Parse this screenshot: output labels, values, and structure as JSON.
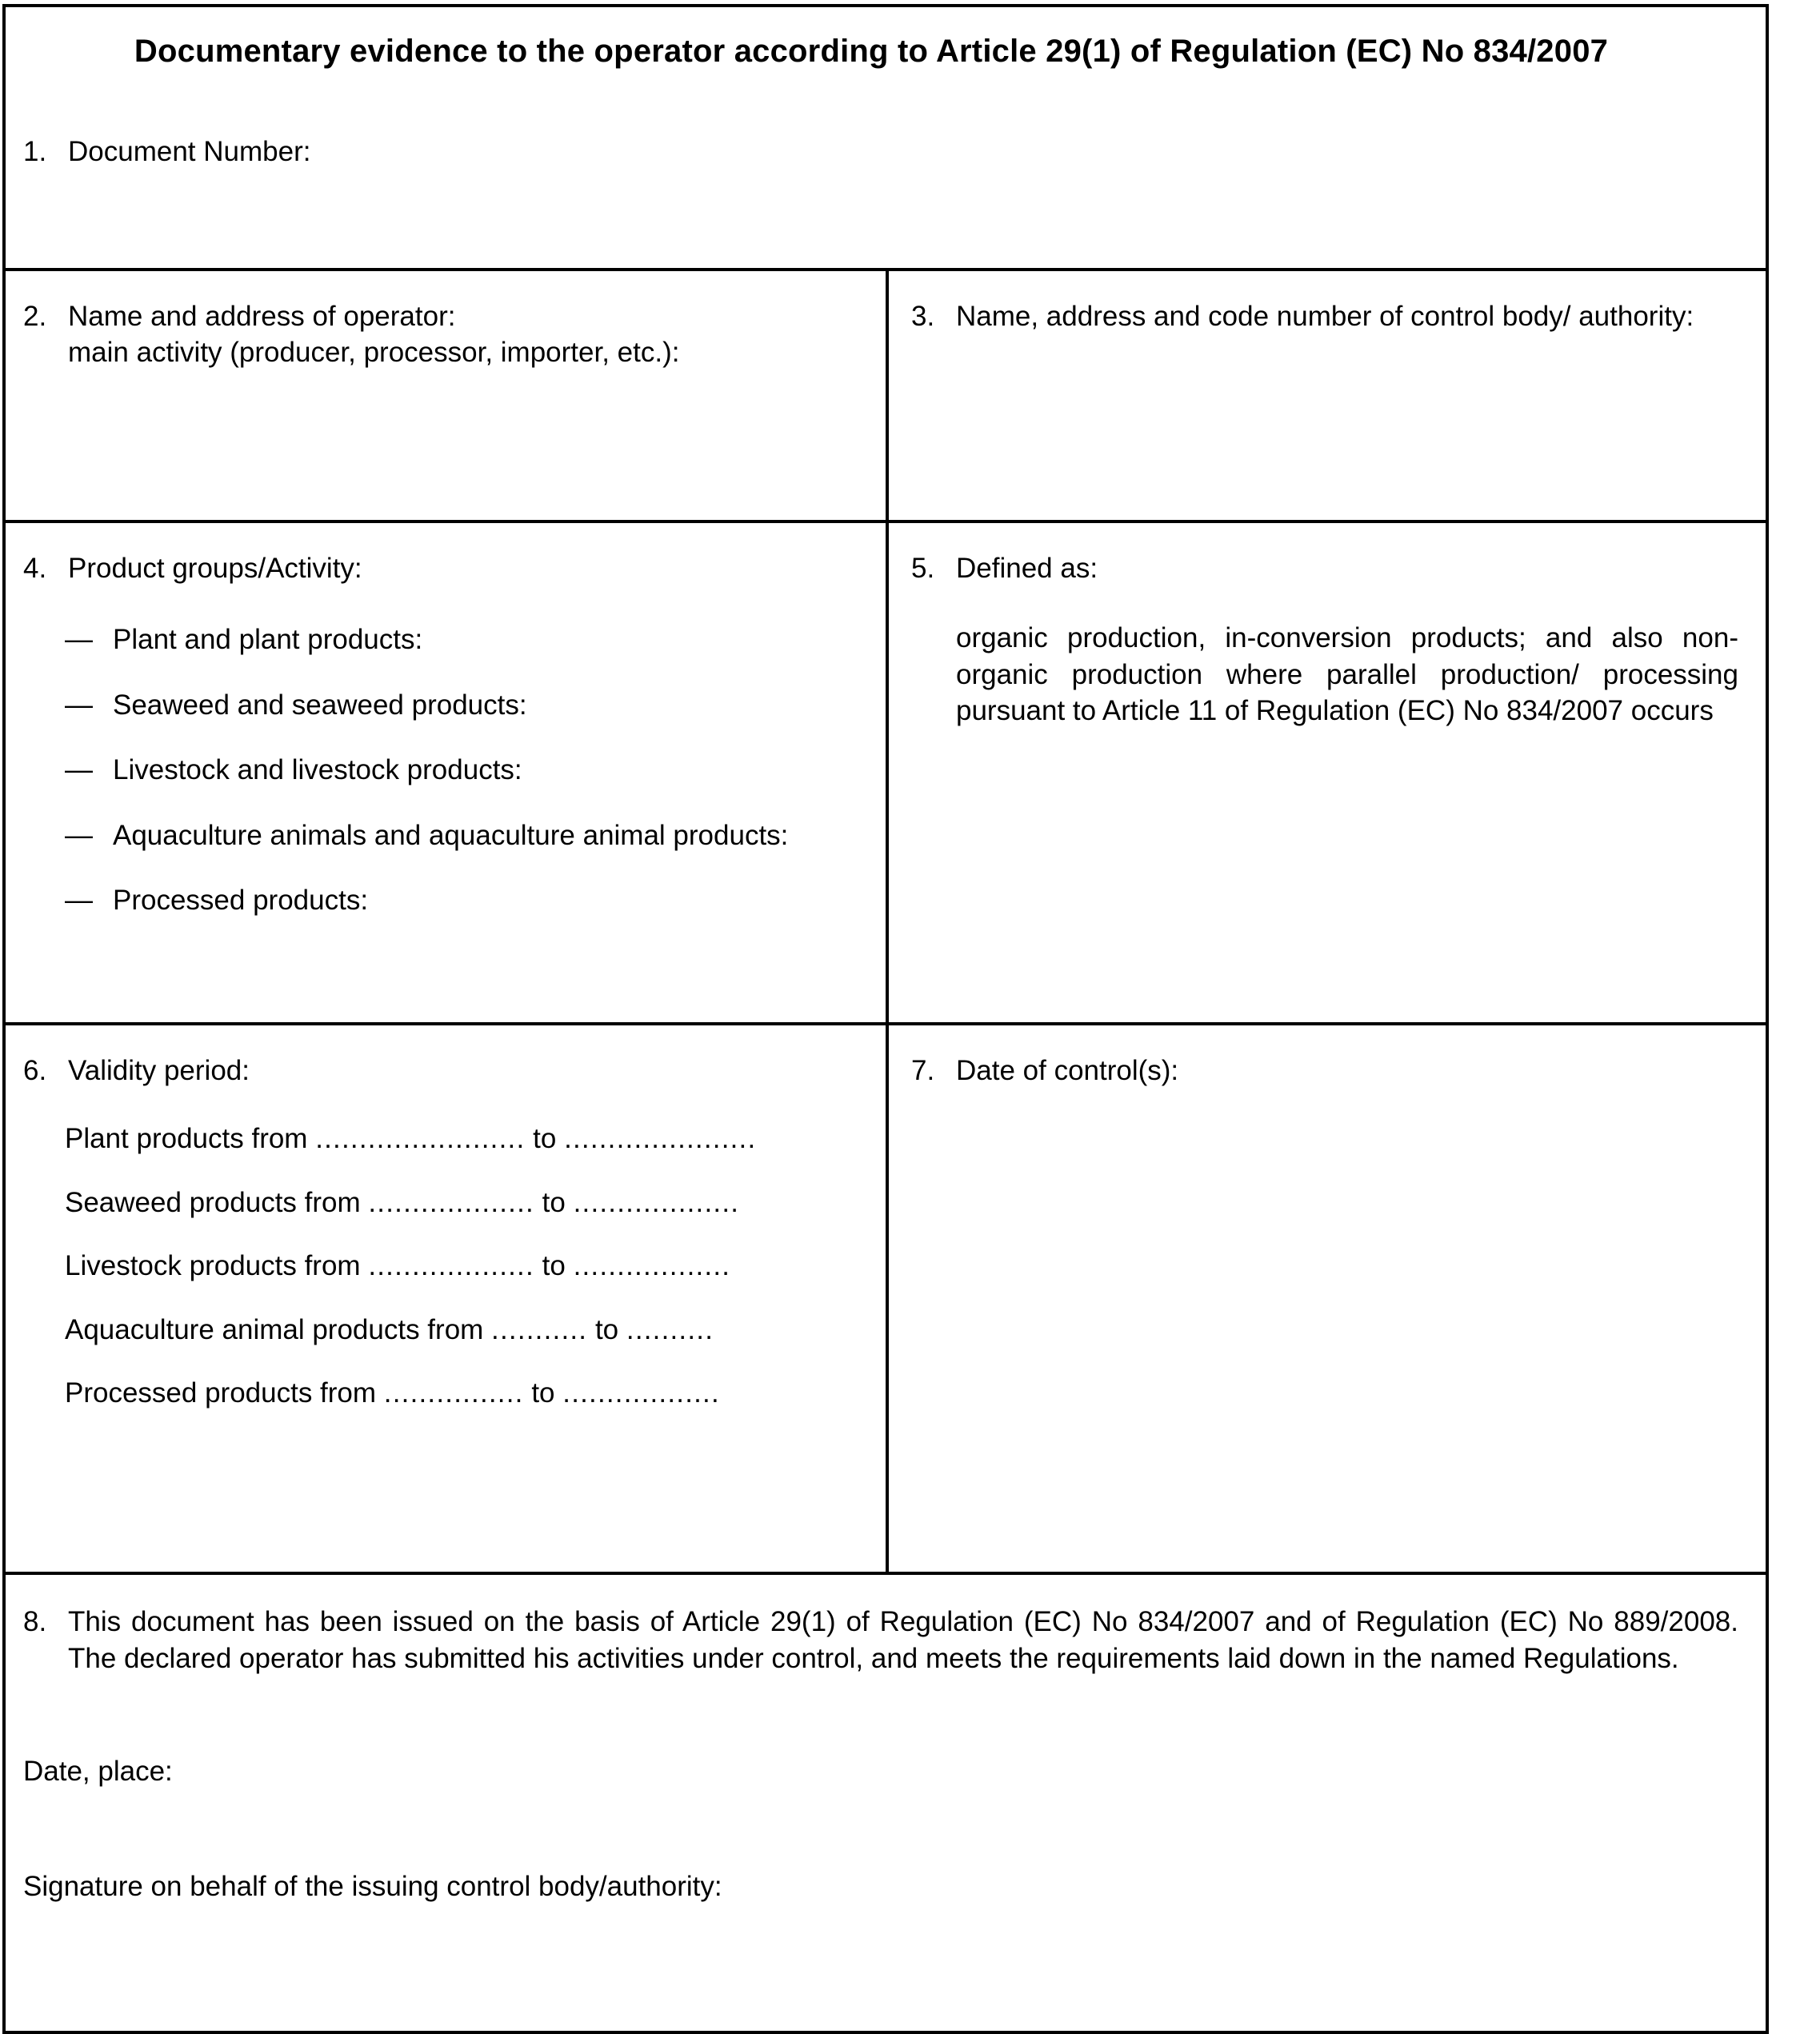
{
  "document": {
    "title": "Documentary evidence to the operator according to Article 29(1) of Regulation (EC) No 834/2007"
  },
  "fields": {
    "document_number": {
      "num": "1.",
      "label": "Document Number:"
    },
    "operator": {
      "num": "2.",
      "label_line1": "Name and address of operator:",
      "label_line2": "main activity (producer, processor, importer, etc.):"
    },
    "control_body": {
      "num": "3.",
      "label": "Name, address and code number of control body/ authority:"
    },
    "product_groups": {
      "num": "4.",
      "label": "Product groups/Activity:",
      "bullet": "—",
      "items": [
        "Plant and plant products:",
        "Seaweed and seaweed products:",
        "Livestock and livestock products:",
        "Aquaculture animals and aquaculture animal products:",
        "Processed products:"
      ]
    },
    "defined_as": {
      "num": "5.",
      "label": "Defined as:",
      "body": "organic production, in-conversion products; and also non-organic production where parallel production/ processing pursuant to Article 11 of Regulation (EC) No 834/2007 occurs"
    },
    "validity_period": {
      "num": "6.",
      "label": "Validity period:",
      "rows": [
        {
          "label": "Plant products from",
          "leader_from": "........................",
          "mid": "to",
          "leader_to": "......................"
        },
        {
          "label": "Seaweed products from",
          "leader_from": "...................",
          "mid": "to",
          "leader_to": "..................."
        },
        {
          "label": "Livestock products from",
          "leader_from": "...................",
          "mid": "to",
          "leader_to": ".................."
        },
        {
          "label": "Aquaculture animal products from",
          "leader_from": "...........",
          "mid": "to",
          "leader_to": ".........."
        },
        {
          "label": "Processed products from",
          "leader_from": "................",
          "mid": "to",
          "leader_to": ".................."
        }
      ]
    },
    "date_of_control": {
      "num": "7.",
      "label": "Date of control(s):"
    },
    "statement": {
      "num": "8.",
      "text": "This document has been issued on the basis of Article 29(1) of Regulation (EC) No 834/2007 and of Regulation (EC) No 889/2008. The declared operator has submitted his activities under control, and meets the requirements laid down in the named Regulations."
    },
    "date_place": {
      "label": "Date, place:"
    },
    "signature": {
      "label": "Signature on behalf of the issuing control body/authority:"
    }
  }
}
